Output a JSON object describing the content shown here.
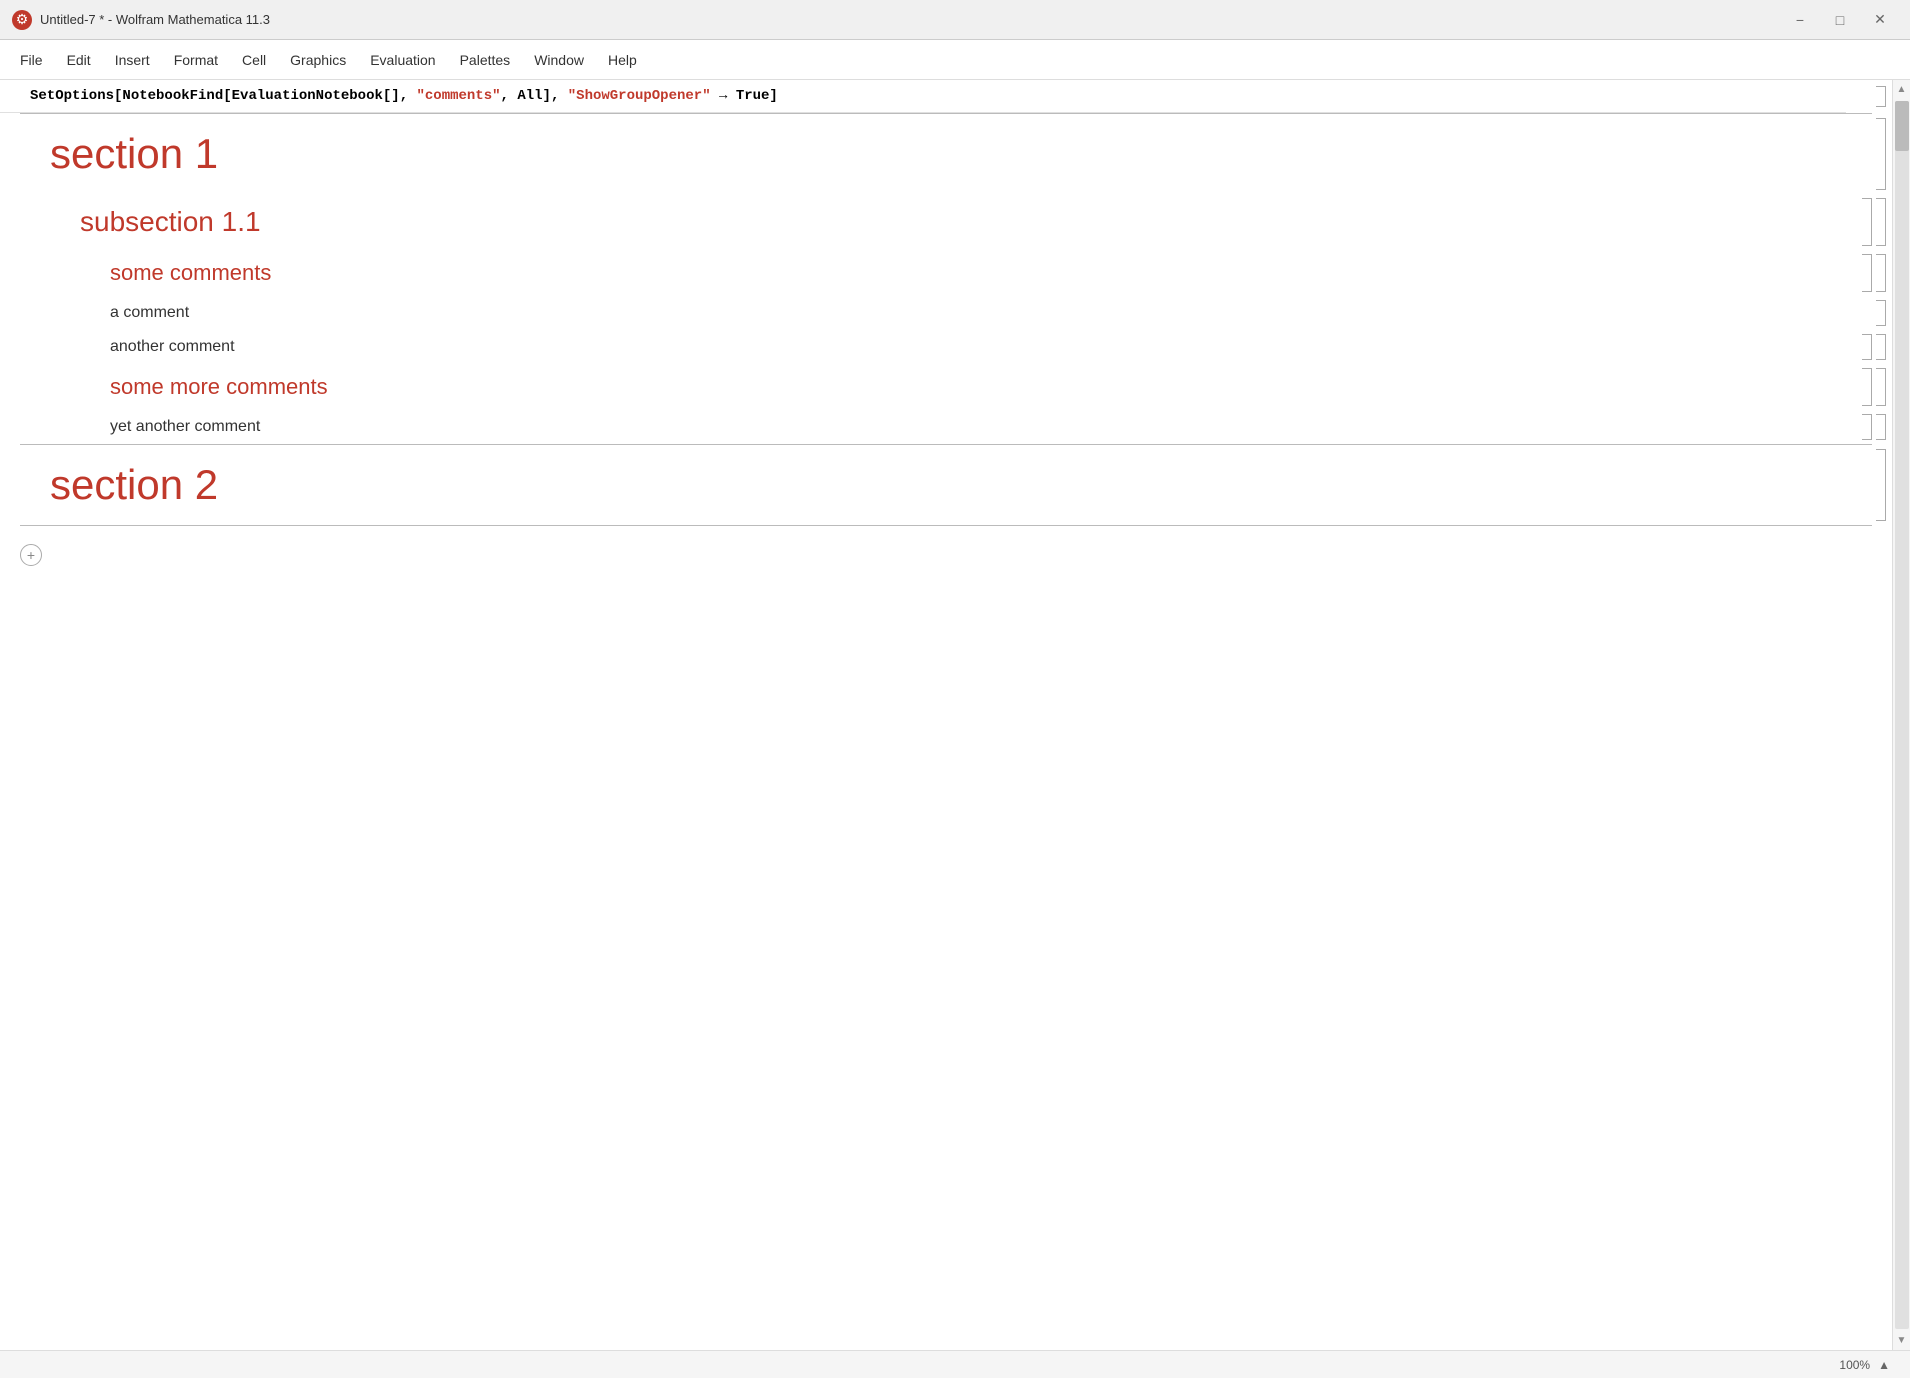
{
  "titleBar": {
    "title": "Untitled-7 * - Wolfram Mathematica 11.3",
    "minimizeLabel": "−",
    "maximizeLabel": "□",
    "closeLabel": "✕"
  },
  "menuBar": {
    "items": [
      "File",
      "Edit",
      "Insert",
      "Format",
      "Cell",
      "Graphics",
      "Evaluation",
      "Palettes",
      "Window",
      "Help"
    ]
  },
  "codeCell": {
    "code": "SetOptions[NotebookFind[EvaluationNotebook[], \"comments\", All], \"ShowGroupOpener\" → True]"
  },
  "notebook": {
    "section1": {
      "heading": "section 1",
      "subsection1_1": {
        "heading": "subsection 1.1",
        "subheading1": "some comments",
        "items": [
          "a comment",
          "another comment"
        ]
      },
      "subheading2": "some more comments",
      "items2": [
        "yet another comment"
      ]
    },
    "section2": {
      "heading": "section 2"
    }
  },
  "statusBar": {
    "zoom": "100%",
    "zoomUpLabel": "▲"
  }
}
